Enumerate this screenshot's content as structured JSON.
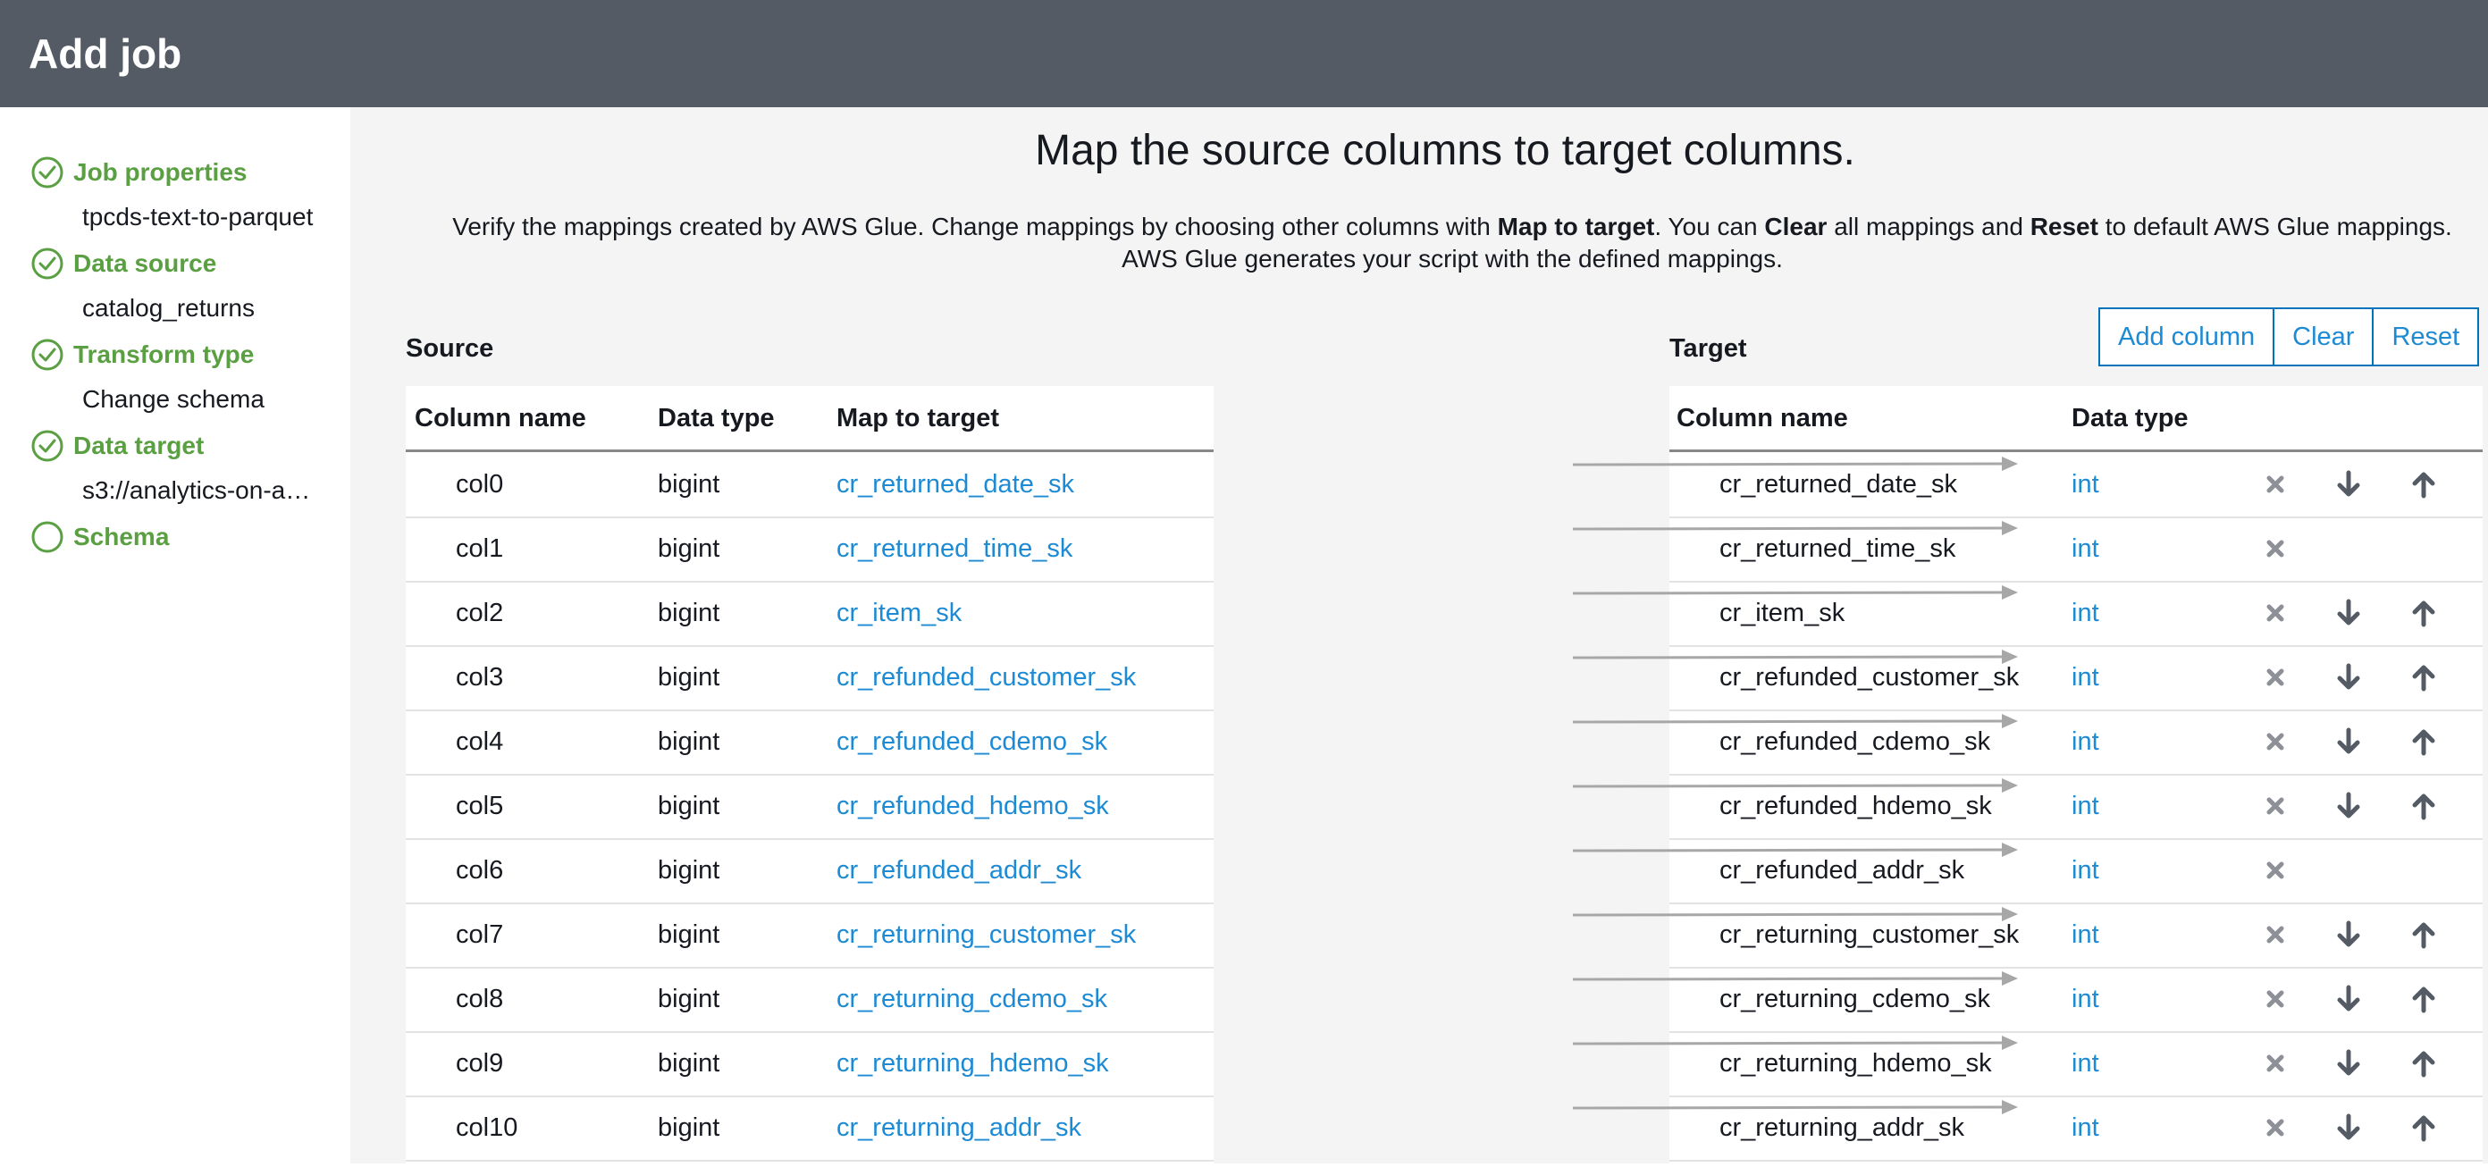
{
  "header": {
    "title": "Add job"
  },
  "sidebar": {
    "steps": [
      {
        "label": "Job properties",
        "sub": "tpcds-text-to-parquet",
        "done": true
      },
      {
        "label": "Data source",
        "sub": "catalog_returns",
        "done": true
      },
      {
        "label": "Transform type",
        "sub": "Change schema",
        "done": true
      },
      {
        "label": "Data target",
        "sub": "s3://analytics-on-a…",
        "done": true
      },
      {
        "label": "Schema",
        "sub": "",
        "done": false
      }
    ]
  },
  "main": {
    "title": "Map the source columns to target columns.",
    "description": {
      "p1": "Verify the mappings created by AWS Glue. Change mappings by choosing other columns with ",
      "b1": "Map to target",
      "p2": ". You can ",
      "b2": "Clear",
      "p3": " all mappings and ",
      "b3": "Reset",
      "p4": " to default AWS Glue mappings.",
      "line2": "AWS Glue generates your script with the defined mappings."
    },
    "source_label": "Source",
    "target_label": "Target",
    "buttons": {
      "add_column": "Add column",
      "clear": "Clear",
      "reset": "Reset"
    },
    "source_headers": {
      "column_name": "Column name",
      "data_type": "Data type",
      "map_to_target": "Map to target"
    },
    "target_headers": {
      "column_name": "Column name",
      "data_type": "Data type"
    },
    "rows": [
      {
        "source_col": "col0",
        "source_type": "bigint",
        "map_to": "cr_returned_date_sk",
        "target_col": "cr_returned_date_sk",
        "target_type": "int",
        "show_move": true
      },
      {
        "source_col": "col1",
        "source_type": "bigint",
        "map_to": "cr_returned_time_sk",
        "target_col": "cr_returned_time_sk",
        "target_type": "int",
        "show_move": false
      },
      {
        "source_col": "col2",
        "source_type": "bigint",
        "map_to": "cr_item_sk",
        "target_col": "cr_item_sk",
        "target_type": "int",
        "show_move": true
      },
      {
        "source_col": "col3",
        "source_type": "bigint",
        "map_to": "cr_refunded_customer_sk",
        "target_col": "cr_refunded_customer_sk",
        "target_type": "int",
        "show_move": true
      },
      {
        "source_col": "col4",
        "source_type": "bigint",
        "map_to": "cr_refunded_cdemo_sk",
        "target_col": "cr_refunded_cdemo_sk",
        "target_type": "int",
        "show_move": true
      },
      {
        "source_col": "col5",
        "source_type": "bigint",
        "map_to": "cr_refunded_hdemo_sk",
        "target_col": "cr_refunded_hdemo_sk",
        "target_type": "int",
        "show_move": true
      },
      {
        "source_col": "col6",
        "source_type": "bigint",
        "map_to": "cr_refunded_addr_sk",
        "target_col": "cr_refunded_addr_sk",
        "target_type": "int",
        "show_move": false
      },
      {
        "source_col": "col7",
        "source_type": "bigint",
        "map_to": "cr_returning_customer_sk",
        "target_col": "cr_returning_customer_sk",
        "target_type": "int",
        "show_move": true
      },
      {
        "source_col": "col8",
        "source_type": "bigint",
        "map_to": "cr_returning_cdemo_sk",
        "target_col": "cr_returning_cdemo_sk",
        "target_type": "int",
        "show_move": true
      },
      {
        "source_col": "col9",
        "source_type": "bigint",
        "map_to": "cr_returning_hdemo_sk",
        "target_col": "cr_returning_hdemo_sk",
        "target_type": "int",
        "show_move": true
      },
      {
        "source_col": "col10",
        "source_type": "bigint",
        "map_to": "cr_returning_addr_sk",
        "target_col": "cr_returning_addr_sk",
        "target_type": "int",
        "show_move": true
      }
    ]
  },
  "icons": {
    "step_done": "check-circle-icon",
    "step_pending": "empty-circle-icon",
    "remove": "x-icon",
    "move_down": "arrow-down-icon",
    "move_up": "arrow-up-icon",
    "mapping_arrow": "right-arrow-connector"
  },
  "colors": {
    "header_bg": "#545b64",
    "step_green": "#5a9f42",
    "link_blue": "#1d8ad4",
    "button_border": "#0073bb",
    "panel_bg": "#f3f4f3",
    "icon_gray": "#8d9096",
    "arrow_gray": "#a7a7a7"
  }
}
